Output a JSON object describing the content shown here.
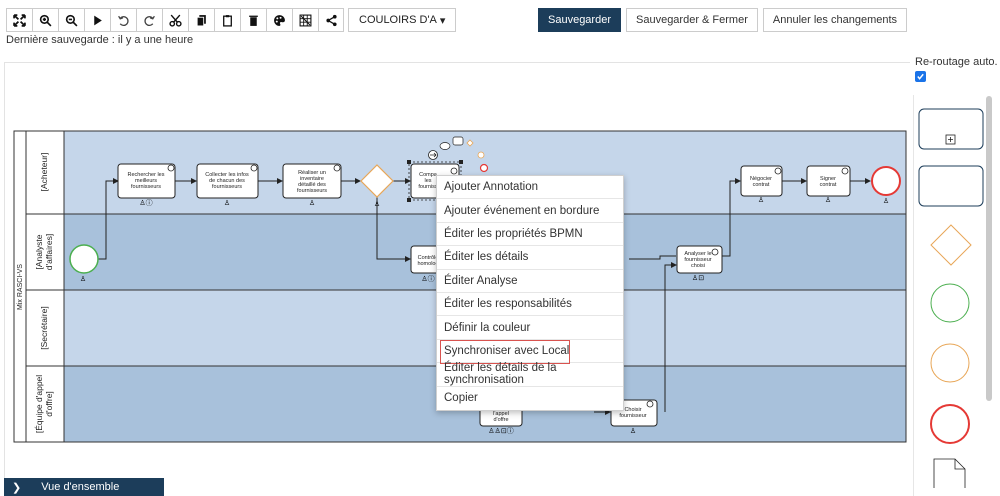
{
  "toolbar": {
    "icons": [
      "fit-icon",
      "zoom-in-icon",
      "zoom-out-icon",
      "play-icon",
      "undo-icon",
      "redo-icon",
      "cut-icon",
      "copy-icon",
      "paste-icon",
      "delete-icon",
      "palette-icon",
      "grid-icon",
      "share-icon"
    ],
    "lanes_dropdown": "COULOIRS D'A"
  },
  "actions": {
    "save": "Sauvegarder",
    "save_close": "Sauvegarder & Fermer",
    "cancel": "Annuler les changements"
  },
  "last_save": "Dernière sauvegarde : il y a une heure",
  "reroute": {
    "label": "Re-routage auto.",
    "checked": true
  },
  "pool": {
    "name": "Mix RASCI-VS"
  },
  "lanes": [
    "[Acheteur]",
    "[Analyste d'affaires]",
    "[Secrétaire]",
    "[Équipe d'appel d'offre]"
  ],
  "tasks": {
    "t1": [
      "Rechercher les",
      "meilleurs",
      "fournisseurs"
    ],
    "t2": [
      "Collecter les infos",
      "de chacun des",
      "fournisseurs"
    ],
    "t3": [
      "Réaliser un",
      "inventaire",
      "détaillé des",
      "fournisseurs"
    ],
    "t4": [
      "Compa",
      "les",
      "fourniss"
    ],
    "t5": [
      "Contrôle",
      "homolog"
    ],
    "t6": [
      "Analyser le",
      "fournisseur",
      "choisi"
    ],
    "t7": [
      "Négocier",
      "contrat"
    ],
    "t8": [
      "Signer",
      "contrat"
    ],
    "t9": [
      "l'appel",
      "d'offre"
    ],
    "t10": [
      "Choisir",
      "fournisseur"
    ]
  },
  "context_menu": {
    "items": [
      "Ajouter Annotation",
      "Ajouter événement en bordure",
      "Éditer les propriétés BPMN",
      "Éditer les détails",
      "Éditer Analyse",
      "Éditer les responsabilités",
      "Définir la couleur",
      "Synchroniser avec Local",
      "Éditer les détails de la synchronisation",
      "Copier"
    ],
    "highlighted": "Synchroniser avec Local"
  },
  "overview": {
    "label": "Vue d'ensemble"
  },
  "colors": {
    "lane_dark": "#a8c1db",
    "lane_light": "#c5d6ea",
    "accent_dark": "#1c3d5a",
    "gateway": "#e8a657",
    "start_event": "#4caf50",
    "end_event": "#e53935"
  }
}
